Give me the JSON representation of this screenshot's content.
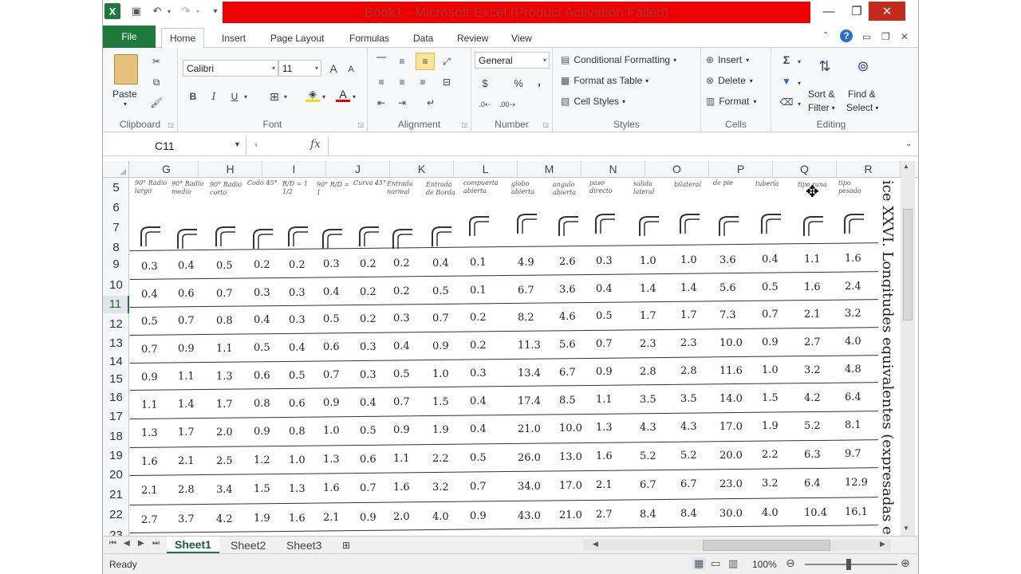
{
  "window": {
    "title": "Book1 - Microsoft Excel (Product Activation Failed)",
    "minimize": "—",
    "maximize": "❐",
    "close": "✕"
  },
  "qat": {
    "logo": "X",
    "save": "💾",
    "undo": "↶",
    "redo": "↷",
    "customize": "▾"
  },
  "tabs": [
    "File",
    "Home",
    "Insert",
    "Page Layout",
    "Formulas",
    "Data",
    "Review",
    "View"
  ],
  "ribbon": {
    "clipboard": {
      "label": "Clipboard",
      "paste": "Paste"
    },
    "font": {
      "label": "Font",
      "name": "Calibri",
      "size": "11",
      "bold": "B",
      "italic": "I",
      "underline": "U",
      "grow": "A",
      "shrink": "A",
      "color": "A"
    },
    "alignment": {
      "label": "Alignment"
    },
    "number": {
      "label": "Number",
      "format": "General",
      "currency": "$",
      "percent": "%",
      "comma": ","
    },
    "styles": {
      "label": "Styles",
      "conditional": "Conditional Formatting",
      "table": "Format as Table",
      "cell": "Cell Styles"
    },
    "cells": {
      "label": "Cells",
      "insert": "Insert",
      "delete": "Delete",
      "format": "Format"
    },
    "editing": {
      "label": "Editing",
      "sum": "Σ",
      "sort": "Sort &",
      "sort2": "Filter",
      "find": "Find &",
      "find2": "Select"
    }
  },
  "formula_bar": {
    "name_box": "C11",
    "fx": "fx",
    "value": ""
  },
  "columns": [
    "G",
    "H",
    "I",
    "J",
    "K",
    "L",
    "M",
    "N",
    "O",
    "P",
    "Q",
    "R"
  ],
  "rows": [
    "5",
    "6",
    "7",
    "8",
    "9",
    "10",
    "11",
    "12",
    "13",
    "14",
    "15",
    "16",
    "17",
    "18",
    "19",
    "20",
    "21",
    "22",
    "23"
  ],
  "active_row": "11",
  "scan": {
    "headers": [
      "90° Radio largo",
      "90° Radio medio",
      "90° Radio corto",
      "Codo 45°",
      "R/D = 1 1/2",
      "90° R/D = 1",
      "Curva 45°",
      "Entrada normal",
      "Entrada de Borda",
      "compuerta abierta",
      "globo abierta",
      "angulo abierta",
      "paso directo",
      "salida lateral",
      "bilateral",
      "de pie",
      "tubería",
      "tipo rana",
      "tipo pesado"
    ],
    "values": [
      [
        "0.3",
        "0.4",
        "0.5",
        "0.2",
        "0.2",
        "0.3",
        "0.2",
        "0.2",
        "0.4",
        "0.1",
        "4.9",
        "2.6",
        "0.3",
        "1.0",
        "1.0",
        "3.6",
        "0.4",
        "1.1",
        "1.6"
      ],
      [
        "0.4",
        "0.6",
        "0.7",
        "0.3",
        "0.3",
        "0.4",
        "0.2",
        "0.2",
        "0.5",
        "0.1",
        "6.7",
        "3.6",
        "0.4",
        "1.4",
        "1.4",
        "5.6",
        "0.5",
        "1.6",
        "2.4"
      ],
      [
        "0.5",
        "0.7",
        "0.8",
        "0.4",
        "0.3",
        "0.5",
        "0.2",
        "0.3",
        "0.7",
        "0.2",
        "8.2",
        "4.6",
        "0.5",
        "1.7",
        "1.7",
        "7.3",
        "0.7",
        "2.1",
        "3.2"
      ],
      [
        "0.7",
        "0.9",
        "1.1",
        "0.5",
        "0.4",
        "0.6",
        "0.3",
        "0.4",
        "0.9",
        "0.2",
        "11.3",
        "5.6",
        "0.7",
        "2.3",
        "2.3",
        "10.0",
        "0.9",
        "2.7",
        "4.0"
      ],
      [
        "0.9",
        "1.1",
        "1.3",
        "0.6",
        "0.5",
        "0.7",
        "0.3",
        "0.5",
        "1.0",
        "0.3",
        "13.4",
        "6.7",
        "0.9",
        "2.8",
        "2.8",
        "11.6",
        "1.0",
        "3.2",
        "4.8"
      ],
      [
        "1.1",
        "1.4",
        "1.7",
        "0.8",
        "0.6",
        "0.9",
        "0.4",
        "0.7",
        "1.5",
        "0.4",
        "17.4",
        "8.5",
        "1.1",
        "3.5",
        "3.5",
        "14.0",
        "1.5",
        "4.2",
        "6.4"
      ],
      [
        "1.3",
        "1.7",
        "2.0",
        "0.9",
        "0.8",
        "1.0",
        "0.5",
        "0.9",
        "1.9",
        "0.4",
        "21.0",
        "10.0",
        "1.3",
        "4.3",
        "4.3",
        "17.0",
        "1.9",
        "5.2",
        "8.1"
      ],
      [
        "1.6",
        "2.1",
        "2.5",
        "1.2",
        "1.0",
        "1.3",
        "0.6",
        "1.1",
        "2.2",
        "0.5",
        "26.0",
        "13.0",
        "1.6",
        "5.2",
        "5.2",
        "20.0",
        "2.2",
        "6.3",
        "9.7"
      ],
      [
        "2.1",
        "2.8",
        "3.4",
        "1.5",
        "1.3",
        "1.6",
        "0.7",
        "1.6",
        "3.2",
        "0.7",
        "34.0",
        "17.0",
        "2.1",
        "6.7",
        "6.7",
        "23.0",
        "3.2",
        "6.4",
        "12.9"
      ],
      [
        "2.7",
        "3.7",
        "4.2",
        "1.9",
        "1.6",
        "2.1",
        "0.9",
        "2.0",
        "4.0",
        "0.9",
        "43.0",
        "21.0",
        "2.7",
        "8.4",
        "8.4",
        "30.0",
        "4.0",
        "10.4",
        "16.1"
      ]
    ],
    "vertical_title": "ice XXVI. Longitudes equivalentes (expresadas e"
  },
  "sheets": [
    "Sheet1",
    "Sheet2",
    "Sheet3"
  ],
  "status": {
    "ready": "Ready",
    "zoom": "100%"
  }
}
